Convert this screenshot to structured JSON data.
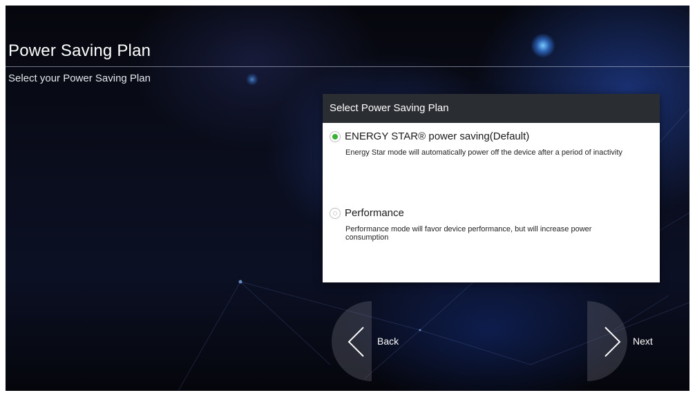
{
  "header": {
    "title": "Power Saving Plan",
    "subtitle": "Select your Power Saving Plan"
  },
  "dialog": {
    "title": "Select Power Saving Plan",
    "options": [
      {
        "label": "ENERGY STAR® power saving(Default)",
        "description": "Energy Star mode will automatically power off the device after a period of inactivity",
        "selected": true
      },
      {
        "label": "Performance",
        "description": "Performance mode will favor device performance, but will increase power consumption",
        "selected": false
      }
    ]
  },
  "navigation": {
    "back_label": "Back",
    "next_label": "Next"
  },
  "colors": {
    "radio_selected": "#38b135",
    "dialog_header": "#2a2d31",
    "background": "#0a0d1c"
  }
}
